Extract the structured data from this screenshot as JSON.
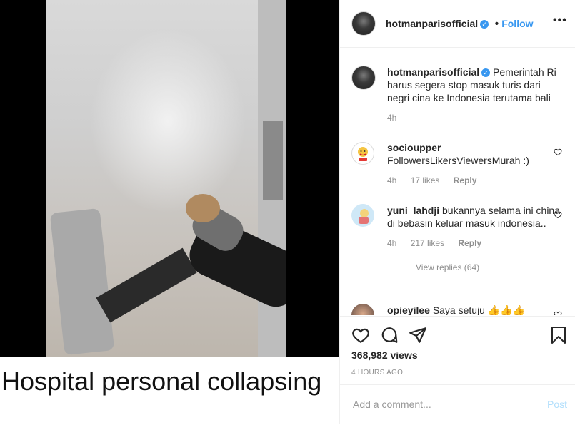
{
  "media": {
    "caption_overlay": "Hospital personal collapsing"
  },
  "header": {
    "username": "hotmanparisofficial",
    "follow_label": "Follow",
    "separator": "•",
    "more_label": "•••"
  },
  "comments": [
    {
      "username": "hotmanparisofficial",
      "verified": true,
      "text": "Pemerintah Ri harus segera stop masuk turis dari negri cina ke Indonesia terutama bali",
      "time": "4h"
    },
    {
      "username": "socioupper",
      "text": "FollowersLikersViewersMurah :)",
      "time": "4h",
      "likes": "17 likes",
      "reply_label": "Reply"
    },
    {
      "username": "yuni_lahdji",
      "text": "bukannya selama ini china di bebasin keluar masuk indonesia..",
      "time": "4h",
      "likes": "217 likes",
      "reply_label": "Reply",
      "view_replies": "View replies (64)"
    },
    {
      "username": "opieyilee",
      "text": "Saya setuju",
      "emoji": "👍👍👍"
    }
  ],
  "footer": {
    "views": "368,982 views",
    "timestamp": "4 HOURS AGO",
    "comment_placeholder": "Add a comment...",
    "post_label": "Post"
  },
  "colors": {
    "accent": "#3897f0",
    "muted": "#8e8e8e",
    "post_disabled": "#b2dffc"
  }
}
